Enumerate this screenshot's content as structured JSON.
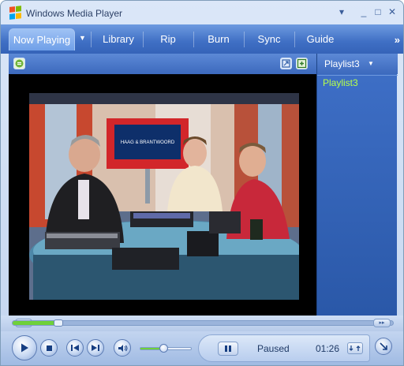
{
  "window": {
    "title": "Windows Media Player",
    "title_buttons": [
      "▾",
      "_",
      "□",
      "✕"
    ]
  },
  "tabs": [
    {
      "label": "Now Playing",
      "active": true
    },
    {
      "label": "Library",
      "active": false
    },
    {
      "label": "Rip",
      "active": false
    },
    {
      "label": "Burn",
      "active": false
    },
    {
      "label": "Sync",
      "active": false
    },
    {
      "label": "Guide",
      "active": false
    }
  ],
  "playlist": {
    "selector_label": "Playlist3",
    "items": [
      "Playlist3"
    ]
  },
  "video": {
    "screen_logo_text": "HAAG & BRANTWOORD"
  },
  "seek": {
    "progress": 0.12
  },
  "volume": {
    "level": 0.45
  },
  "status": {
    "state": "Paused",
    "time": "01:26"
  },
  "colors": {
    "accent_blue": "#3f6fc4",
    "playlist_item_green": "#b7ff4a",
    "progress_green": "#6fd13a"
  },
  "icons": [
    "windows-logo-icon",
    "play-icon",
    "stop-icon",
    "previous-icon",
    "next-icon",
    "mute-icon",
    "pause-icon"
  ]
}
